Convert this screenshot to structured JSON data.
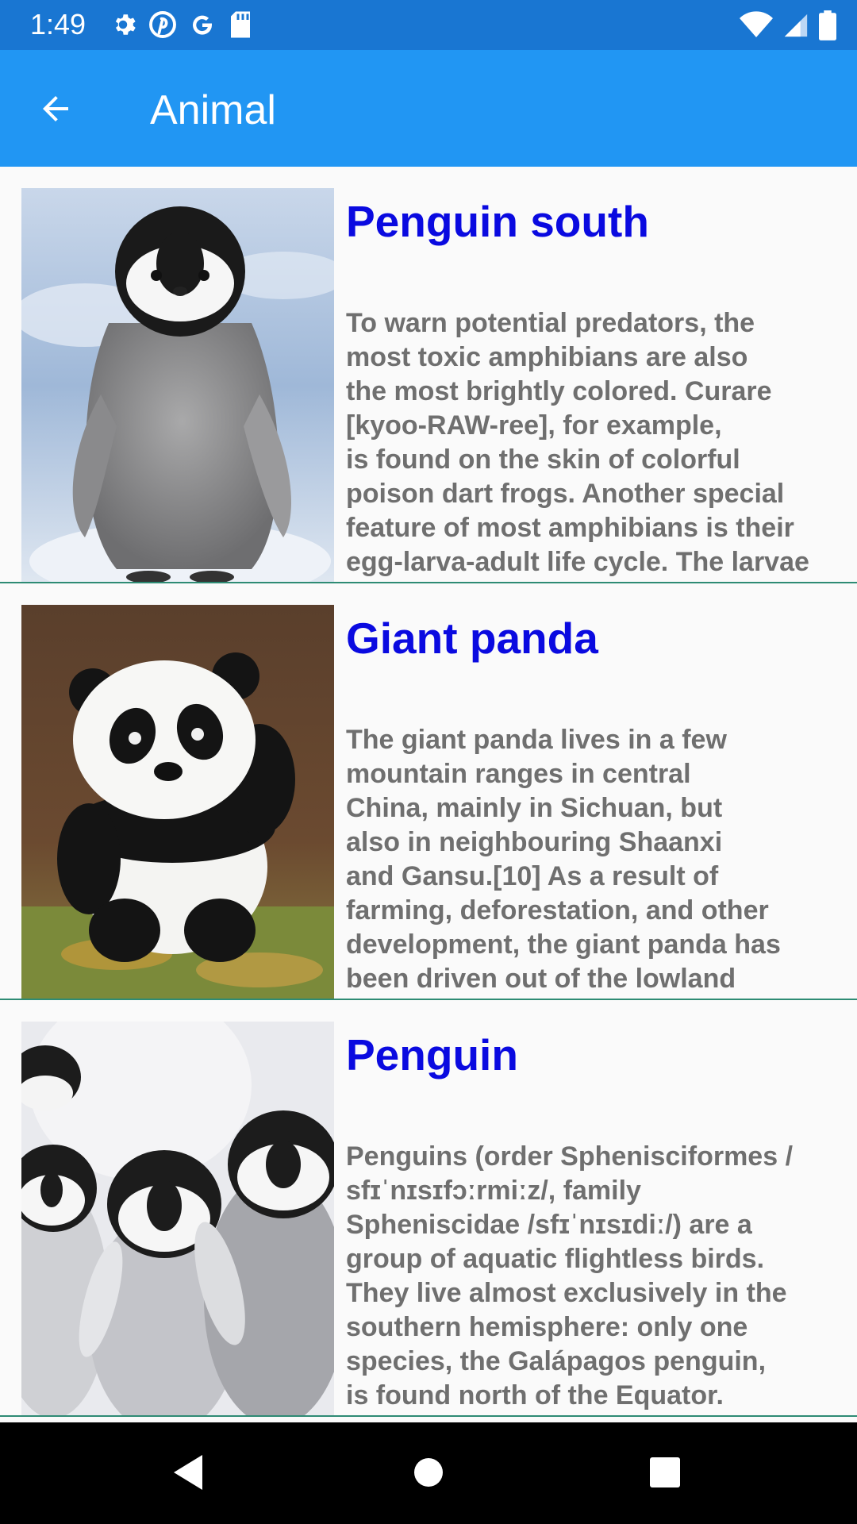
{
  "status_bar": {
    "time": "1:49",
    "left_icons": [
      "gear-icon",
      "pinterest-icon",
      "google-icon",
      "sd-card-icon"
    ],
    "right_icons": [
      "wifi-icon",
      "signal-icon",
      "battery-icon"
    ]
  },
  "app_bar": {
    "title": "Animal",
    "back_icon": "arrow-back-icon"
  },
  "items": [
    {
      "title": "Penguin south",
      "description": "To warn potential predators, the\nmost toxic amphibians are also\nthe most brightly colored. Curare\n[kyoo-RAW-ree], for example,\nis found on the skin of colorful\npoison dart frogs. Another special\nfeature of most amphibians is their\negg-larva-adult life cycle. The larvae"
    },
    {
      "title": "Giant panda",
      "description": "The giant panda lives in a few\nmountain ranges in central\nChina, mainly in Sichuan, but\nalso in neighbouring Shaanxi\nand Gansu.[10] As a result of\nfarming, deforestation, and other\ndevelopment, the giant panda has\nbeen driven out of the lowland"
    },
    {
      "title": "Penguin",
      "description": "Penguins (order Sphenisciformes /\nsfɪˈnɪsɪfɔːrmiːz/, family\nSpheniscidae /sfɪˈnɪsɪdiː/) are a\ngroup of aquatic flightless birds.\nThey live almost exclusively in the\nsouthern hemisphere: only one\nspecies, the Galápagos penguin,\nis found north of the Equator."
    }
  ],
  "nav_bar": {
    "buttons": [
      "back-triangle-icon",
      "home-circle-icon",
      "recents-square-icon"
    ]
  },
  "colors": {
    "status_bar": "#1976d2",
    "app_bar": "#2196f3",
    "title_text": "#0a0ae0",
    "desc_text": "#6f6f6f",
    "divider": "#2e8b74"
  }
}
